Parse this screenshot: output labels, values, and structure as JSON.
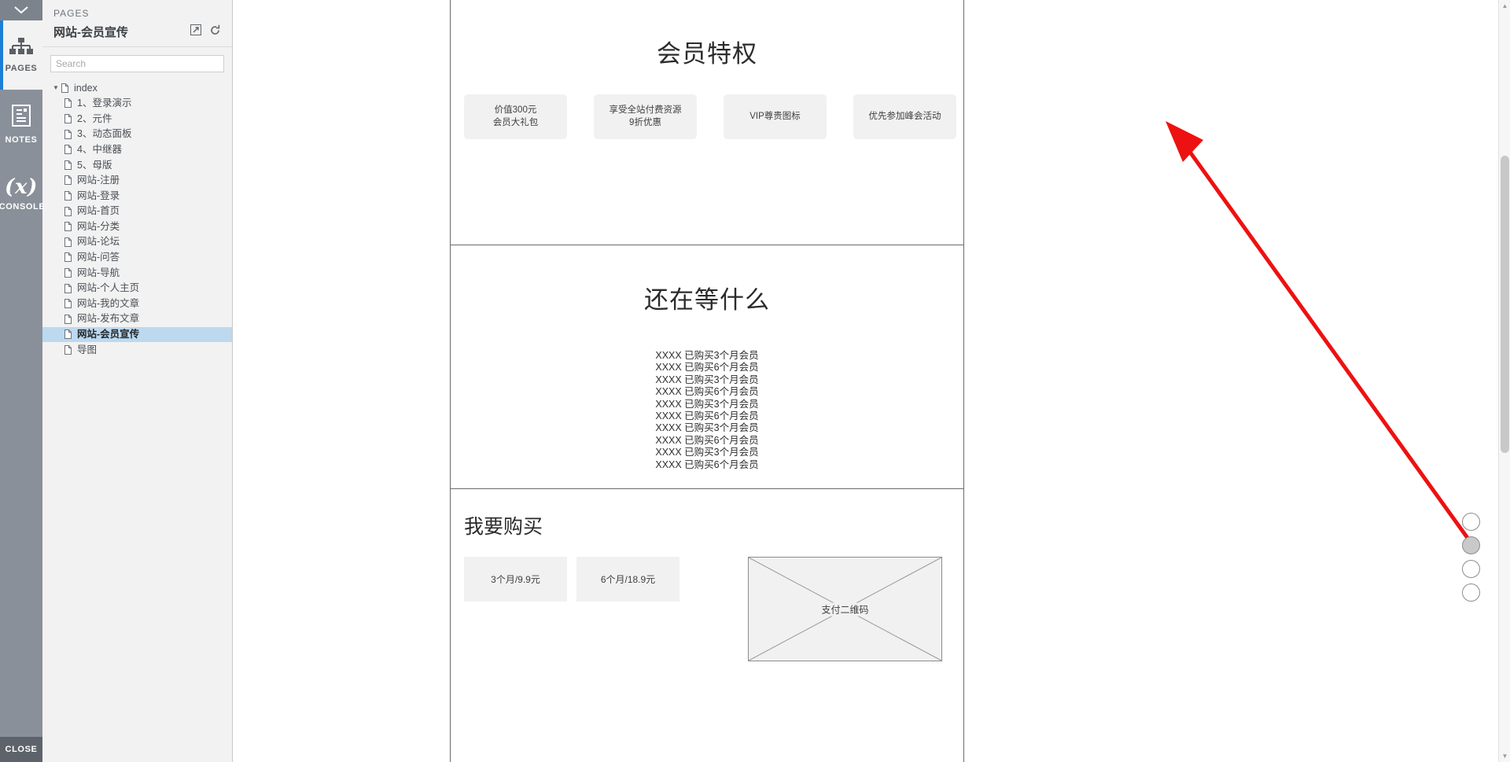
{
  "rail": {
    "collapse_icon": "chevron-down-icon",
    "items": [
      {
        "label": "PAGES",
        "icon": "sitemap-icon",
        "active": true
      },
      {
        "label": "NOTES",
        "icon": "notes-icon",
        "active": false
      },
      {
        "label": "CONSOLE",
        "icon": "(x)",
        "active": false
      }
    ],
    "close_label": "CLOSE"
  },
  "pages_panel": {
    "kicker": "PAGES",
    "title": "网站-会员宣传",
    "action_icons": [
      "open-in-new-icon",
      "refresh-icon"
    ],
    "search": {
      "value": "",
      "placeholder": "Search"
    },
    "tree": [
      {
        "label": "index",
        "depth": 0,
        "caret": "▼",
        "selected": false
      },
      {
        "label": "1、登录演示",
        "depth": 1,
        "caret": "",
        "selected": false
      },
      {
        "label": "2、元件",
        "depth": 1,
        "caret": "",
        "selected": false
      },
      {
        "label": "3、动态面板",
        "depth": 1,
        "caret": "",
        "selected": false
      },
      {
        "label": "4、中继器",
        "depth": 1,
        "caret": "",
        "selected": false
      },
      {
        "label": "5、母版",
        "depth": 1,
        "caret": "",
        "selected": false
      },
      {
        "label": "网站-注册",
        "depth": 1,
        "caret": "",
        "selected": false
      },
      {
        "label": "网站-登录",
        "depth": 1,
        "caret": "",
        "selected": false
      },
      {
        "label": "网站-首页",
        "depth": 1,
        "caret": "",
        "selected": false
      },
      {
        "label": "网站-分类",
        "depth": 1,
        "caret": "",
        "selected": false
      },
      {
        "label": "网站-论坛",
        "depth": 1,
        "caret": "",
        "selected": false
      },
      {
        "label": "网站-问答",
        "depth": 1,
        "caret": "",
        "selected": false
      },
      {
        "label": "网站-导航",
        "depth": 1,
        "caret": "",
        "selected": false
      },
      {
        "label": "网站-个人主页",
        "depth": 1,
        "caret": "",
        "selected": false
      },
      {
        "label": "网站-我的文章",
        "depth": 1,
        "caret": "",
        "selected": false
      },
      {
        "label": "网站-发布文章",
        "depth": 1,
        "caret": "",
        "selected": false
      },
      {
        "label": "网站-会员宣传",
        "depth": 1,
        "caret": "",
        "selected": true
      },
      {
        "label": "导图",
        "depth": 1,
        "caret": "",
        "selected": false
      }
    ]
  },
  "wireframe": {
    "section_perks": {
      "heading": "会员特权",
      "cards": [
        "价值300元\n会员大礼包",
        "享受全站付费资源\n9折优惠",
        "VIP尊贵图标",
        "优先参加峰会活动"
      ]
    },
    "section_waiting": {
      "heading": "还在等什么",
      "rows": [
        "XXXX 已购买3个月会员",
        "XXXX 已购买6个月会员",
        "XXXX 已购买3个月会员",
        "XXXX 已购买6个月会员",
        "XXXX 已购买3个月会员",
        "XXXX 已购买6个月会员",
        "XXXX 已购买3个月会员",
        "XXXX 已购买6个月会员",
        "XXXX 已购买3个月会员",
        "XXXX 已购买6个月会员"
      ]
    },
    "section_buy": {
      "heading": "我要购买",
      "price_options": [
        "3个月/9.9元",
        "6个月/18.9元"
      ],
      "qr_label": "支付二维码"
    }
  },
  "pagination": {
    "dots": [
      {
        "filled": false
      },
      {
        "filled": true
      },
      {
        "filled": false
      },
      {
        "filled": false
      }
    ]
  },
  "annotation": {
    "color": "#ee1111",
    "type": "arrow"
  }
}
